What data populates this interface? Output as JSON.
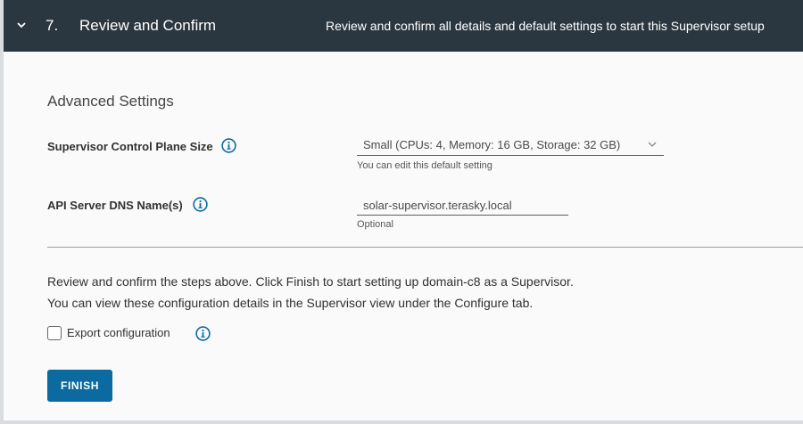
{
  "step": {
    "number": "7.",
    "title": "Review and Confirm",
    "description": "Review and confirm all details and default settings to start this Supervisor setup"
  },
  "advanced": {
    "title": "Advanced Settings",
    "control_plane": {
      "label": "Supervisor Control Plane Size",
      "value": "Small (CPUs: 4, Memory: 16 GB, Storage: 32 GB)",
      "helper": "You can edit this default setting"
    },
    "dns": {
      "label": "API Server DNS Name(s)",
      "value": "solar-supervisor.terasky.local",
      "helper": "Optional"
    }
  },
  "review": {
    "line1": "Review and confirm the steps above. Click Finish to start setting up domain-c8 as a Supervisor.",
    "line2": "You can view these configuration details in the Supervisor view under the Configure tab."
  },
  "export": {
    "label": "Export configuration",
    "checked": false
  },
  "finish_button": "FINISH",
  "colors": {
    "header_bg": "#2b3740",
    "primary_button": "#0b6aa0",
    "info_icon": "#0b6aa0"
  },
  "icons": {
    "collapse": "chevron-down-icon",
    "info": "info-circle-icon",
    "dropdown": "caret-down-icon"
  }
}
